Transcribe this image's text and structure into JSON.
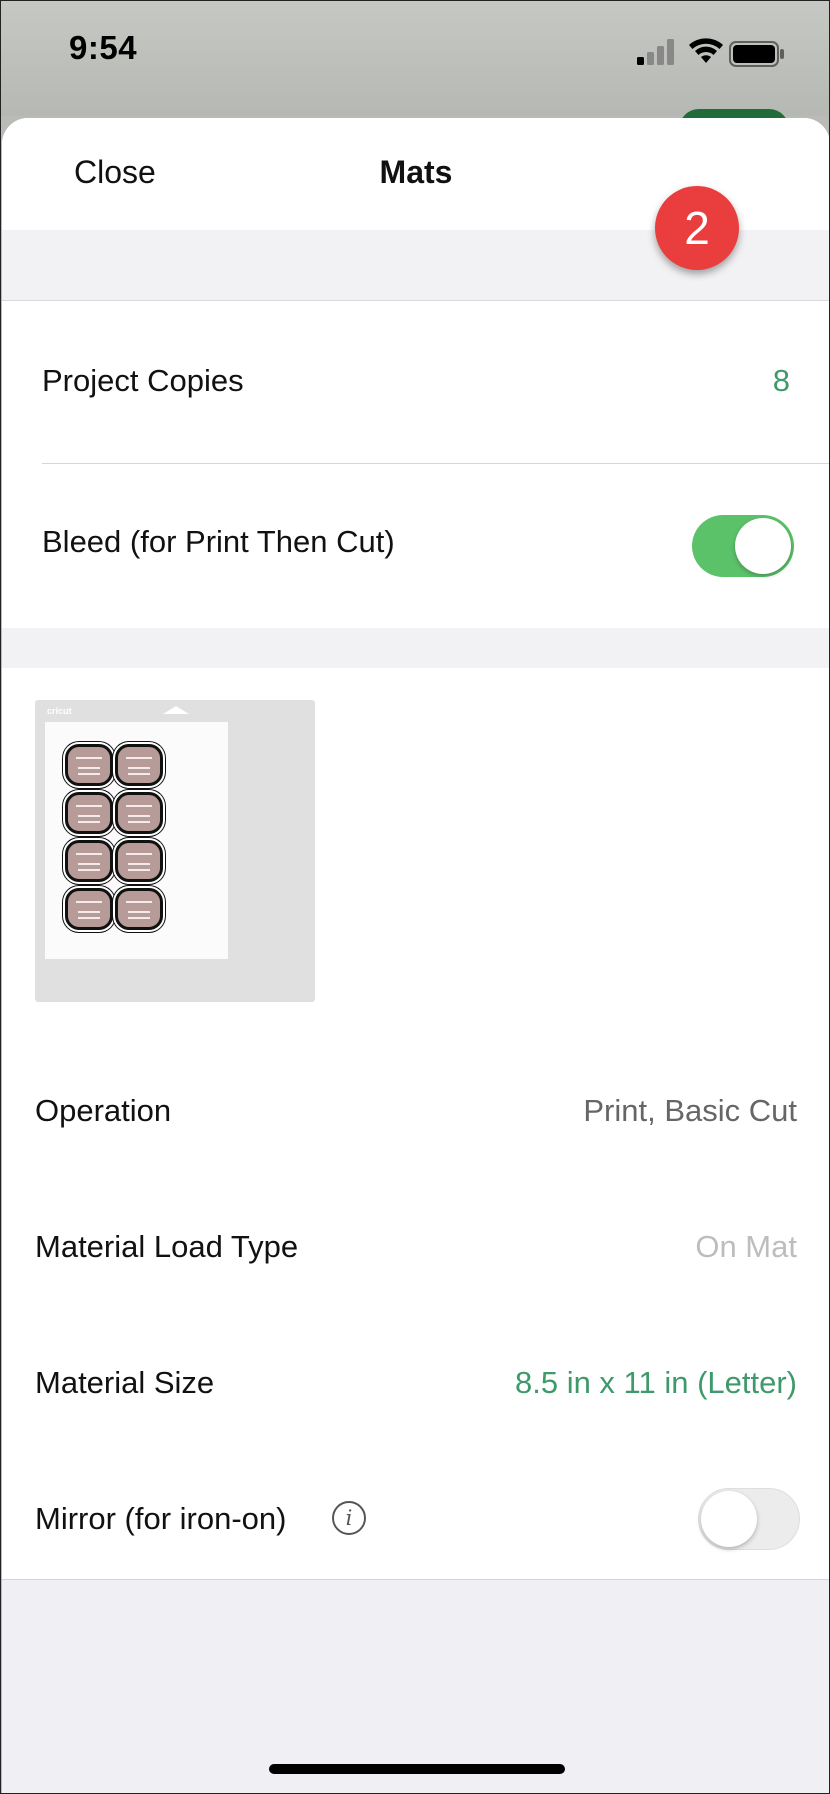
{
  "status_bar": {
    "time": "9:54"
  },
  "nav": {
    "close_label": "Close",
    "title": "Mats"
  },
  "settings": {
    "project_copies_label": "Project Copies",
    "project_copies_value": "8",
    "bleed_label": "Bleed (for Print Then Cut)",
    "bleed_on": true
  },
  "annotation": {
    "badge": "2"
  },
  "mat_preview": {
    "logo": "cricut"
  },
  "details": {
    "operation_label": "Operation",
    "operation_value": "Print, Basic Cut",
    "load_type_label": "Material Load Type",
    "load_type_value": "On Mat",
    "size_label": "Material Size",
    "size_value": "8.5 in x 11 in (Letter)",
    "mirror_label": "Mirror (for iron-on)",
    "mirror_on": false
  },
  "colors": {
    "accent_green": "#3f9a6b",
    "toggle_on": "#5cc26a",
    "badge_red": "#ea3d3d",
    "muted_text": "#bdbdbd",
    "value_text": "#666666"
  }
}
